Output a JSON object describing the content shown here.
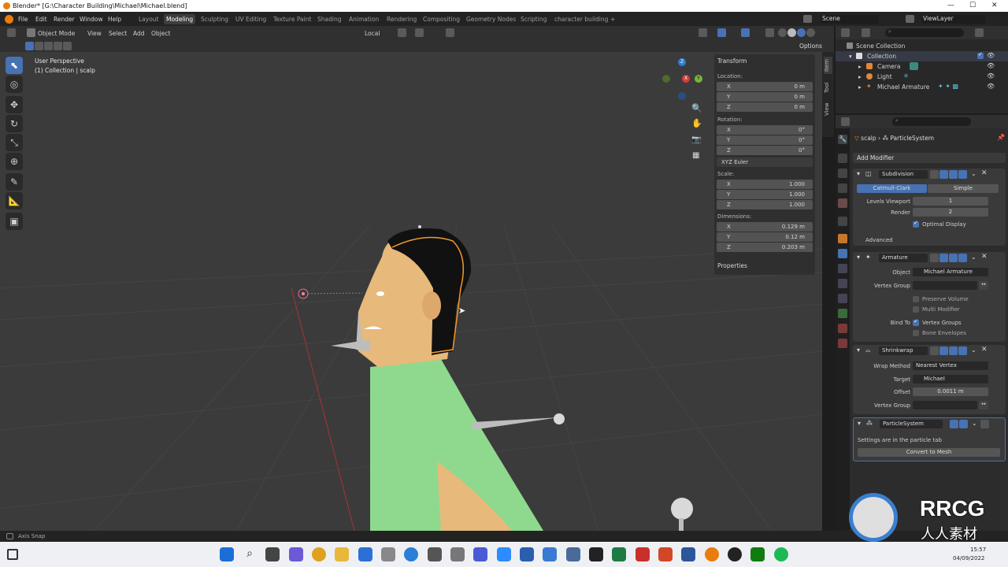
{
  "window": {
    "title": "Blender* [G:\\Character Building\\Michael\\Michael.blend]"
  },
  "menu": [
    "File",
    "Edit",
    "Render",
    "Window",
    "Help"
  ],
  "workspaces": [
    "Layout",
    "Modeling",
    "Sculpting",
    "UV Editing",
    "Texture Paint",
    "Shading",
    "Animation",
    "Rendering",
    "Compositing",
    "Geometry Nodes",
    "Scripting",
    "character building",
    "+"
  ],
  "active_workspace": "Modeling",
  "scene": "Scene",
  "view_layer": "ViewLayer",
  "viewport_header": {
    "mode": "Object Mode",
    "view": "View",
    "select": "Select",
    "add": "Add",
    "object": "Object",
    "orientation": "Local",
    "options": "Options"
  },
  "viewport": {
    "perspective": "User Perspective",
    "collection_info": "(1) Collection | scalp"
  },
  "gizmo": {
    "x": "X",
    "y": "Y",
    "z": "Z"
  },
  "npanel": {
    "transform": "Transform",
    "location_label": "Location:",
    "location": [
      {
        "axis": "X",
        "value": "0 m"
      },
      {
        "axis": "Y",
        "value": "0 m"
      },
      {
        "axis": "Z",
        "value": "0 m"
      }
    ],
    "rotation_label": "Rotation:",
    "rotation": [
      {
        "axis": "X",
        "value": "0°"
      },
      {
        "axis": "Y",
        "value": "0°"
      },
      {
        "axis": "Z",
        "value": "0°"
      }
    ],
    "rotation_mode": "XYZ Euler",
    "scale_label": "Scale:",
    "scale": [
      {
        "axis": "X",
        "value": "1.000"
      },
      {
        "axis": "Y",
        "value": "1.000"
      },
      {
        "axis": "Z",
        "value": "1.000"
      }
    ],
    "dimensions_label": "Dimensions:",
    "dimensions": [
      {
        "axis": "X",
        "value": "0.129 m"
      },
      {
        "axis": "Y",
        "value": "0.12 m"
      },
      {
        "axis": "Z",
        "value": "0.203 m"
      }
    ],
    "properties": "Properties",
    "tabs": [
      "Item",
      "Tool",
      "View"
    ]
  },
  "outliner": {
    "scene_collection": "Scene Collection",
    "items": [
      "Collection",
      "Camera",
      "Light",
      "Michael Armature"
    ]
  },
  "properties": {
    "breadcrumb_obj": "scalp",
    "breadcrumb_sys": "ParticleSystem",
    "add_modifier": "Add Modifier",
    "subdivision": {
      "name": "Subdivision",
      "opt_a": "Catmull-Clark",
      "opt_b": "Simple",
      "levels_label": "Levels Viewport",
      "levels": "1",
      "render_label": "Render",
      "render": "2",
      "optimal": "Optimal Display",
      "advanced": "Advanced"
    },
    "armature": {
      "name": "Armature",
      "object_label": "Object",
      "object": "Michael Armature",
      "vgroup_label": "Vertex Group",
      "preserve": "Preserve Volume",
      "multi": "Multi Modifier",
      "bind_label": "Bind To",
      "vgroups": "Vertex Groups",
      "envelopes": "Bone Envelopes"
    },
    "shrinkwrap": {
      "name": "Shrinkwrap",
      "method_label": "Wrap Method",
      "method": "Nearest Vertex",
      "target_label": "Target",
      "target": "Michael",
      "offset_label": "Offset",
      "offset": "0.0011 m",
      "vgroup_label": "Vertex Group"
    },
    "particle": {
      "name": "ParticleSystem",
      "note": "Settings are in the particle tab",
      "convert": "Convert to Mesh"
    }
  },
  "status": {
    "axis_snap": "Axis Snap"
  },
  "taskbar": {
    "time": "15:57",
    "date": "04/09/2022"
  },
  "watermark": {
    "text": "RRCG",
    "sub": "人人素材"
  }
}
